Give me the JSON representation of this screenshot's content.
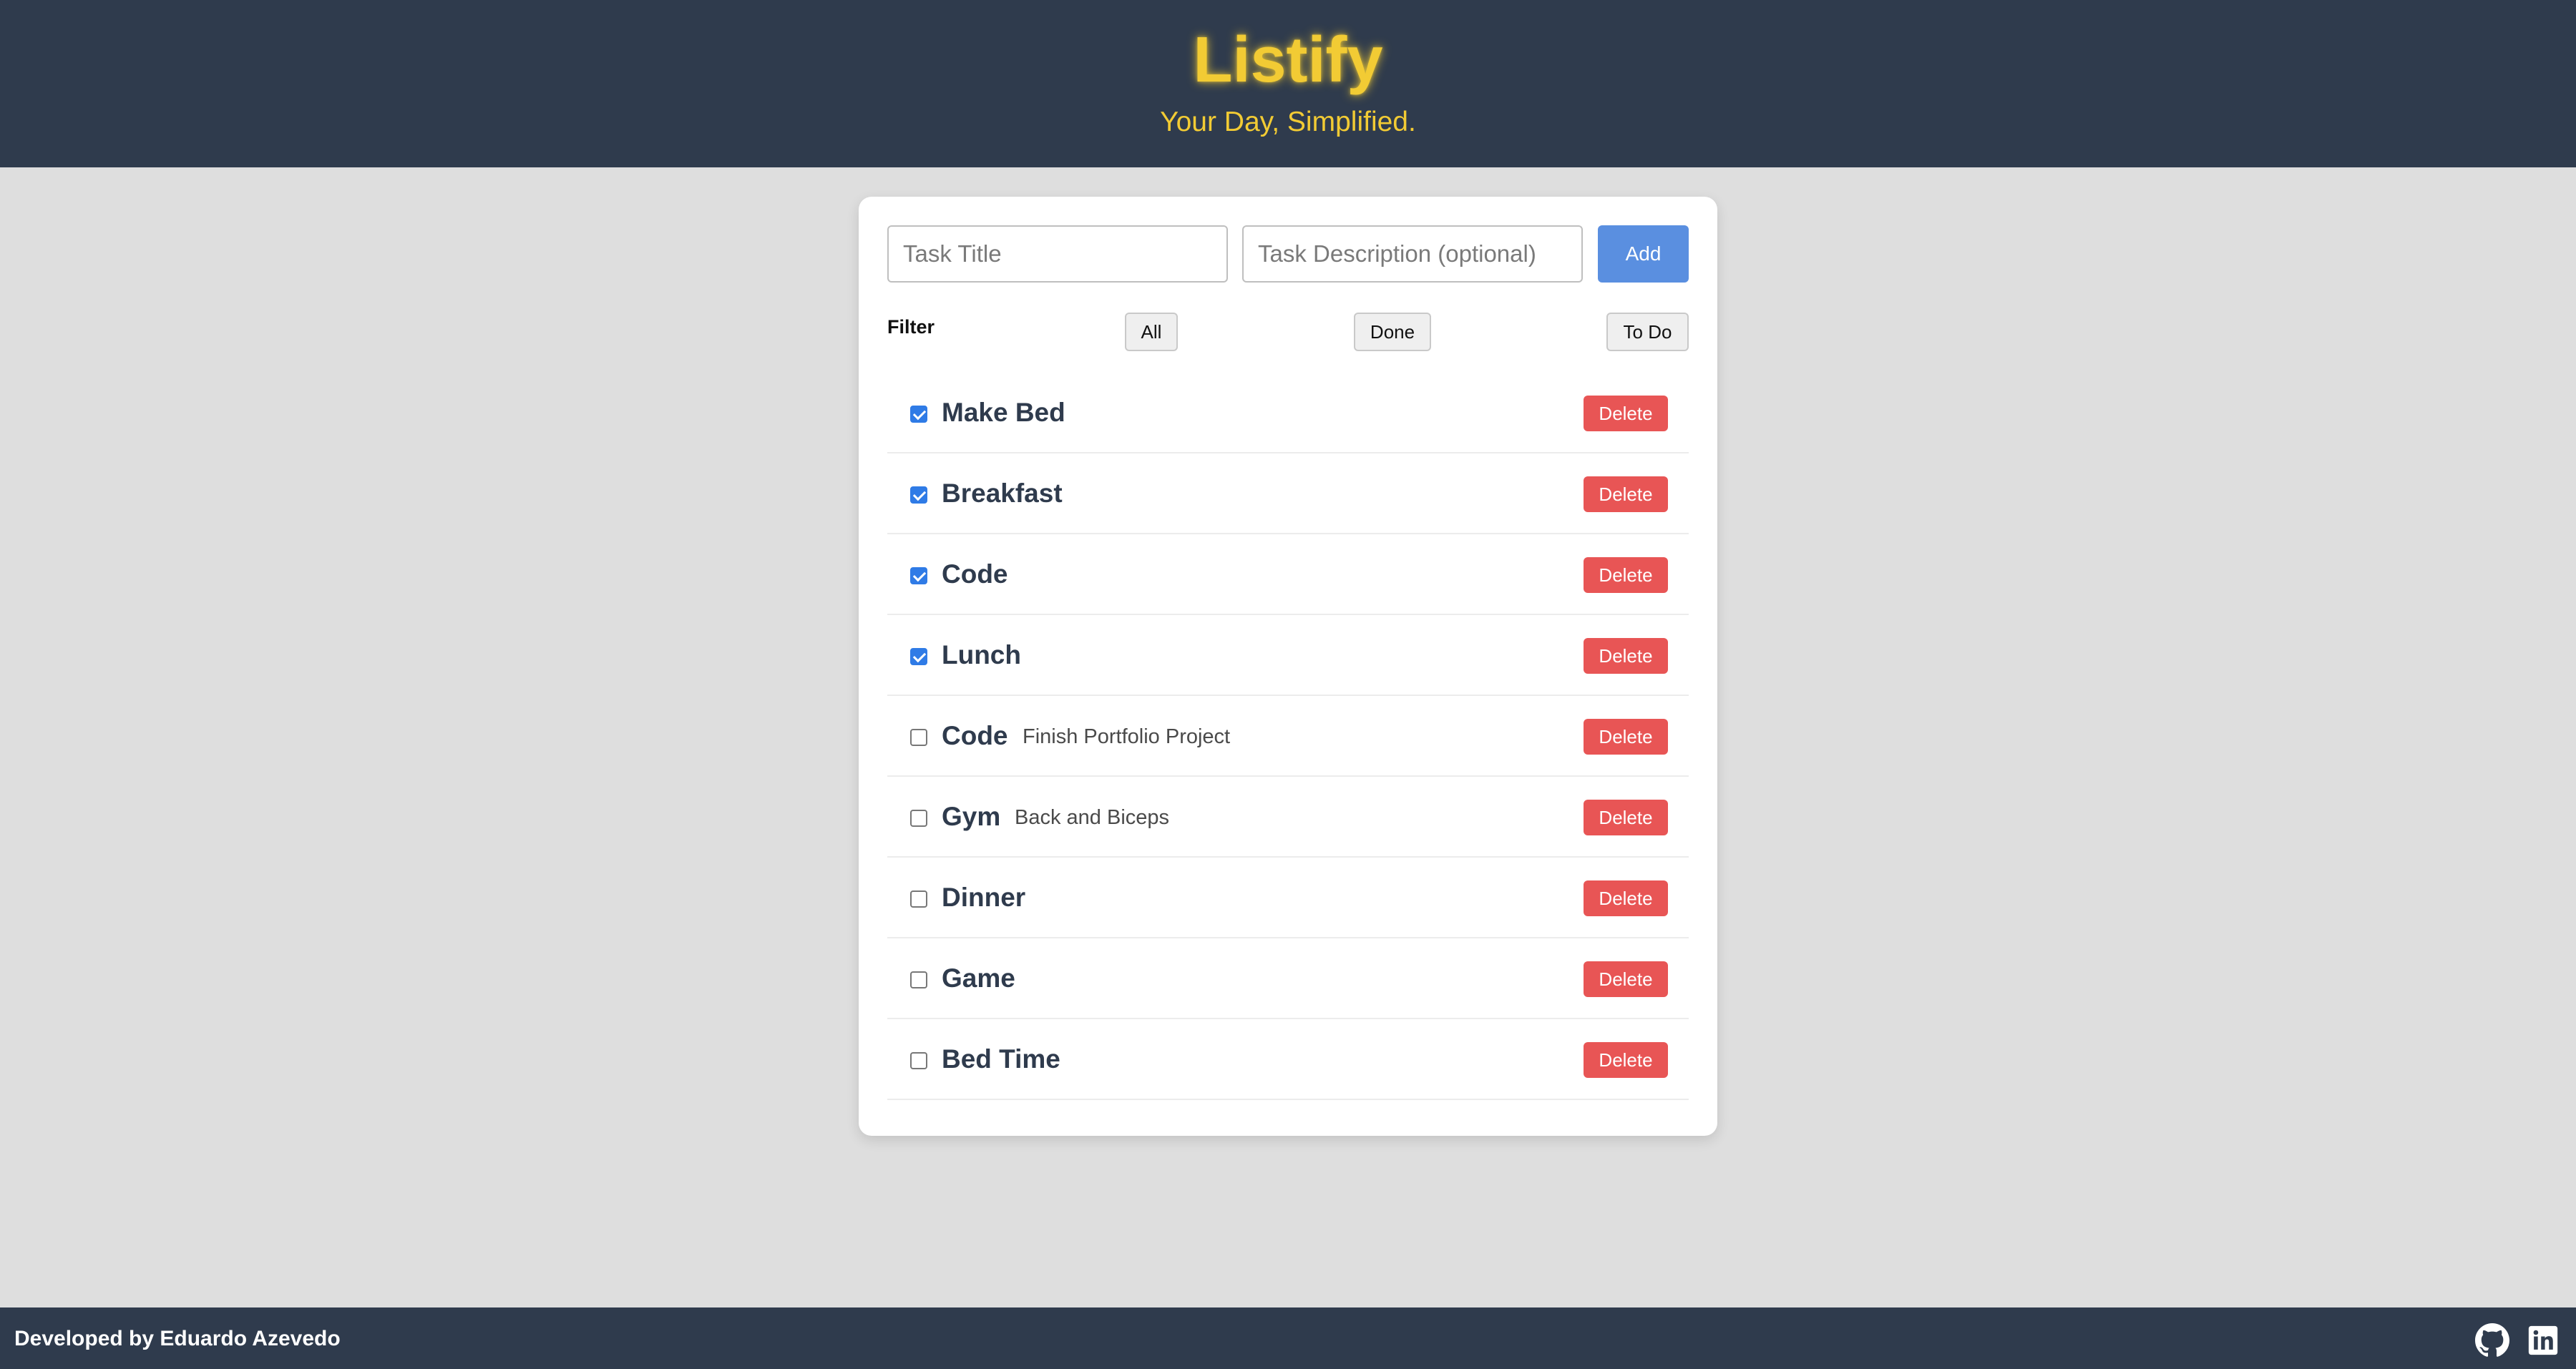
{
  "header": {
    "title": "Listify",
    "subtitle": "Your Day, Simplified."
  },
  "form": {
    "title_placeholder": "Task Title",
    "title_value": "",
    "description_placeholder": "Task Description (optional)",
    "description_value": "",
    "add_label": "Add"
  },
  "filter": {
    "label": "Filter",
    "options": [
      "All",
      "Done",
      "To Do"
    ]
  },
  "tasks": [
    {
      "title": "Make Bed",
      "description": "",
      "done": true,
      "delete_label": "Delete"
    },
    {
      "title": "Breakfast",
      "description": "",
      "done": true,
      "delete_label": "Delete"
    },
    {
      "title": "Code",
      "description": "",
      "done": true,
      "delete_label": "Delete"
    },
    {
      "title": "Lunch",
      "description": "",
      "done": true,
      "delete_label": "Delete"
    },
    {
      "title": "Code",
      "description": "Finish Portfolio Project",
      "done": false,
      "delete_label": "Delete"
    },
    {
      "title": "Gym",
      "description": "Back and Biceps",
      "done": false,
      "delete_label": "Delete"
    },
    {
      "title": "Dinner",
      "description": "",
      "done": false,
      "delete_label": "Delete"
    },
    {
      "title": "Game",
      "description": "",
      "done": false,
      "delete_label": "Delete"
    },
    {
      "title": "Bed Time",
      "description": "",
      "done": false,
      "delete_label": "Delete"
    }
  ],
  "footer": {
    "credit": "Developed by Eduardo Azevedo",
    "icons": [
      "github-icon",
      "linkedin-icon"
    ]
  },
  "colors": {
    "header_bg": "#2f3b4d",
    "accent_yellow": "#f2cb34",
    "add_button": "#5a8fe0",
    "delete_button": "#e85555",
    "checkbox_checked": "#2f7be6",
    "page_bg": "#dedede"
  }
}
